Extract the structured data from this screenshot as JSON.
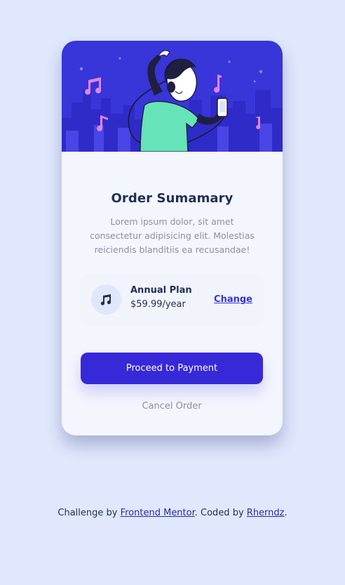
{
  "colors": {
    "page_background": "#e0e8fd",
    "card_background": "#f3f6fd",
    "hero_background": "#3835d9",
    "primary_button": "#3729d8",
    "heading_text": "#1f2f56",
    "muted_text": "#8b90a5"
  },
  "hero": {
    "illustration": "person-dancing-with-headphones-illustration"
  },
  "order_summary": {
    "title": "Order Sumamary",
    "description": "Lorem ipsum dolor, sit amet consectetur adipisicing elit. Molestias reiciendis blanditiis ea recusandae!"
  },
  "plan": {
    "icon": "music-note-icon",
    "name": "Annual Plan",
    "price": "$59.99/year",
    "change_label": "Change"
  },
  "actions": {
    "proceed_label": "Proceed to Payment",
    "cancel_label": "Cancel Order"
  },
  "attribution": {
    "prefix": "Challenge by ",
    "challenge_link": "Frontend Mentor",
    "middle": ". Coded by ",
    "author_link": "Rherndz",
    "suffix": "."
  }
}
